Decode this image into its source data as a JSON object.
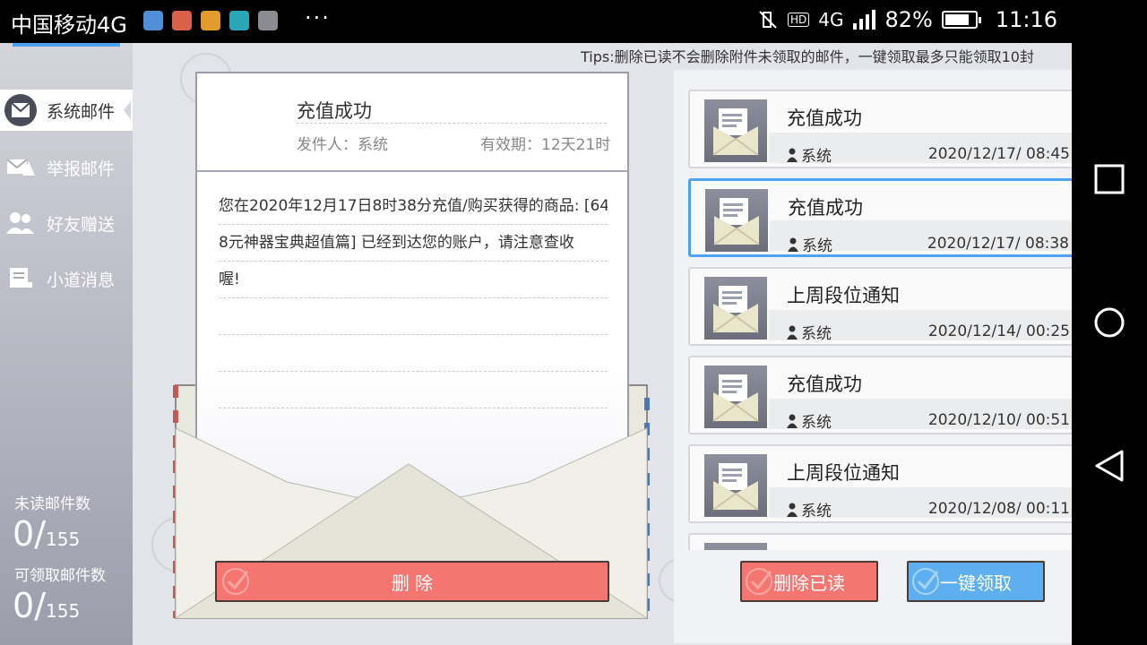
{
  "statusbar": {
    "carrier": "中国移动4G",
    "more": "···",
    "hd": "HD",
    "net": "4G",
    "battery_text": "82%",
    "battery_level": 0.82,
    "time": "11:16"
  },
  "tips": "Tips:删除已读不会删除附件未领取的邮件，一键领取最多只能领取10封",
  "sidebar": {
    "items": [
      {
        "label": "系统邮件",
        "icon": "system-mail-icon",
        "active": true
      },
      {
        "label": "举报邮件",
        "icon": "report-mail-icon",
        "active": false
      },
      {
        "label": "好友赠送",
        "icon": "friends-icon",
        "active": false
      },
      {
        "label": "小道消息",
        "icon": "news-icon",
        "active": false
      }
    ],
    "unread_label": "未读邮件数",
    "unread_count": "0",
    "unread_total": "155",
    "claimable_label": "可领取邮件数",
    "claimable_count": "0",
    "claimable_total": "155"
  },
  "letter": {
    "title": "充值成功",
    "sender_label": "发件人：系统",
    "expiry_label": "有效期：12天21时",
    "body_lines": [
      "您在2020年12月17日8时38分充值/购买获得的商品: [64",
      "8元神器宝典超值篇] 已经到达您的账户，请注意查收",
      "喔!"
    ],
    "delete_label": "删 除"
  },
  "mails": [
    {
      "title": "充值成功",
      "sender": "系统",
      "date": "2020/12/17/ 08:45",
      "selected": false
    },
    {
      "title": "充值成功",
      "sender": "系统",
      "date": "2020/12/17/ 08:38",
      "selected": true
    },
    {
      "title": "上周段位通知",
      "sender": "系统",
      "date": "2020/12/14/ 00:25",
      "selected": false
    },
    {
      "title": "充值成功",
      "sender": "系统",
      "date": "2020/12/10/ 00:51",
      "selected": false
    },
    {
      "title": "上周段位通知",
      "sender": "系统",
      "date": "2020/12/08/ 00:11",
      "selected": false
    }
  ],
  "actions": {
    "delete_read": "删除已读",
    "claim_all": "一键领取"
  },
  "colors": {
    "accent_blue": "#5dafef",
    "accent_red": "#f57570",
    "selected_border": "#4ea3f0"
  }
}
